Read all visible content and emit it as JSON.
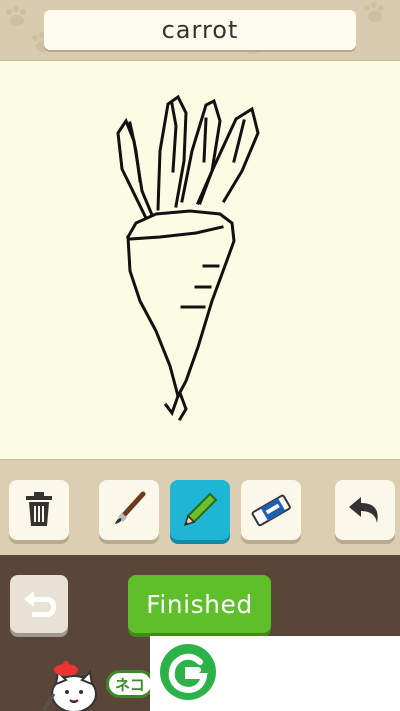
{
  "header": {
    "word": "carrot"
  },
  "toolbar": {
    "tools": [
      {
        "name": "trash",
        "icon": "trash-icon"
      },
      {
        "name": "brush",
        "icon": "brush-icon"
      },
      {
        "name": "pencil",
        "icon": "pencil-icon",
        "active": true
      },
      {
        "name": "eraser",
        "icon": "eraser-icon"
      },
      {
        "name": "undo",
        "icon": "undo-icon"
      }
    ]
  },
  "actions": {
    "back_icon": "back-arrow-icon",
    "finished_label": "Finished"
  },
  "ad": {
    "logo": "green-g-logo-icon",
    "pill_text": "ネコ"
  },
  "colors": {
    "accent_active": "#1fb6d6",
    "finished_green": "#5fbf2a",
    "bottom_bg": "#5a4638"
  }
}
